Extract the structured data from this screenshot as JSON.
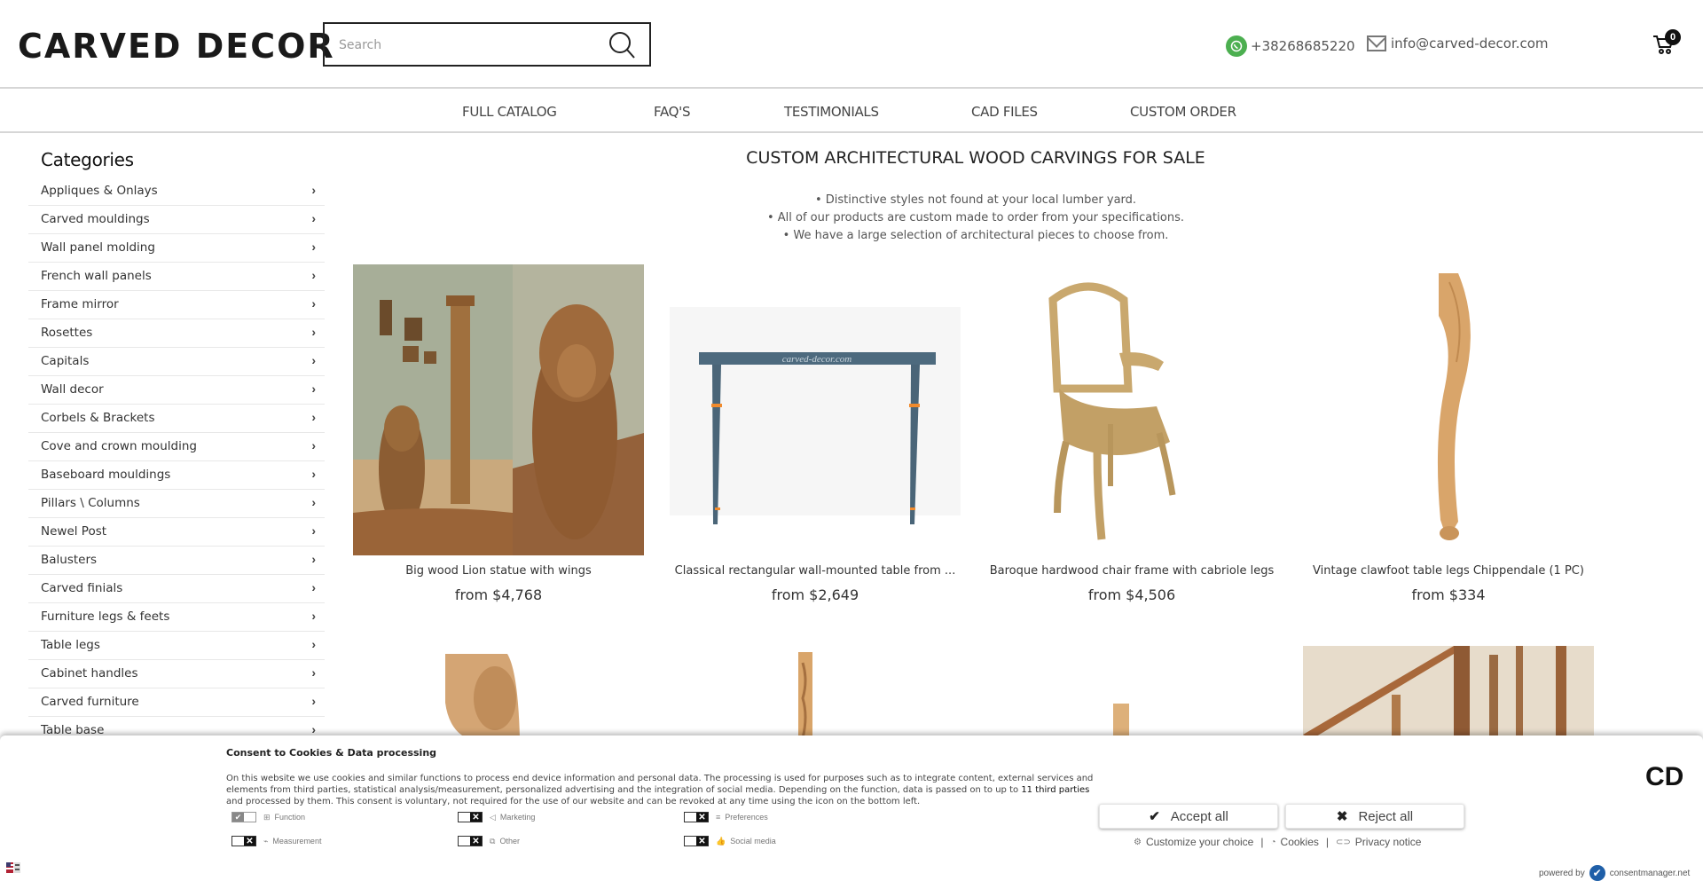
{
  "header": {
    "logo": "CARVED DECOR",
    "search_placeholder": "Search",
    "phone": "+38268685220",
    "email": "info@carved-decor.com",
    "cart_count": "0"
  },
  "nav": [
    {
      "label": "FULL CATALOG"
    },
    {
      "label": "FAQ'S"
    },
    {
      "label": "TESTIMONIALS"
    },
    {
      "label": "CAD FILES"
    },
    {
      "label": "CUSTOM ORDER"
    }
  ],
  "sidebar": {
    "title": "Categories",
    "items": [
      {
        "label": "Appliques & Onlays"
      },
      {
        "label": "Carved mouldings"
      },
      {
        "label": "Wall panel molding"
      },
      {
        "label": "French wall panels"
      },
      {
        "label": "Frame mirror"
      },
      {
        "label": "Rosettes"
      },
      {
        "label": "Capitals"
      },
      {
        "label": "Wall decor"
      },
      {
        "label": "Corbels & Brackets"
      },
      {
        "label": "Cove and crown moulding"
      },
      {
        "label": "Baseboard mouldings"
      },
      {
        "label": "Pillars \\ Columns"
      },
      {
        "label": "Newel Post"
      },
      {
        "label": "Balusters"
      },
      {
        "label": "Carved finials"
      },
      {
        "label": "Furniture legs & feets"
      },
      {
        "label": "Table legs"
      },
      {
        "label": "Cabinet handles"
      },
      {
        "label": "Carved furniture"
      },
      {
        "label": "Table base"
      }
    ]
  },
  "main": {
    "title": "CUSTOM ARCHITECTURAL WOOD CARVINGS FOR SALE",
    "bullets": [
      "• Distinctive styles not found at your local lumber yard.",
      "• All of our products are custom made to order from your specifications.",
      "• We have a large selection of architectural pieces to choose from."
    ],
    "products": [
      {
        "name": "Big wood Lion statue with wings",
        "price": "from $4,768"
      },
      {
        "name": "Classical rectangular wall-mounted table from ...",
        "price": "from $2,649"
      },
      {
        "name": "Baroque hardwood chair frame with cabriole legs",
        "price": "from $4,506"
      },
      {
        "name": "Vintage clawfoot table legs Chippendale (1 PC)",
        "price": "from $334"
      }
    ],
    "table_watermark": "carved-decor.com"
  },
  "cookie": {
    "title": "Consent to Cookies & Data processing",
    "text_1": "On this website we use cookies and similar functions to process end device information and personal data. The processing is used for purposes such as to integrate content, external services and elements from third parties, statistical analysis/measurement, personalized advertising and the integration of social media. Depending on the function, data is passed on to up to ",
    "text_highlight": "11 third parties",
    "text_2": " and processed by them. This consent is voluntary, not required for the use of our website and can be revoked at any time using the icon on the bottom left.",
    "toggles": [
      {
        "label": "Function",
        "on": true
      },
      {
        "label": "Marketing",
        "on": false
      },
      {
        "label": "Preferences",
        "on": false
      },
      {
        "label": "Measurement",
        "on": false
      },
      {
        "label": "Other",
        "on": false
      },
      {
        "label": "Social media",
        "on": false
      }
    ],
    "brand": "CD",
    "accept_label": "Accept all",
    "reject_label": "Reject all",
    "customize_label": "Customize your choice",
    "cookies_label": "Cookies",
    "privacy_label": "Privacy notice",
    "powered_by": "powered by",
    "provider": "consentmanager.net"
  }
}
